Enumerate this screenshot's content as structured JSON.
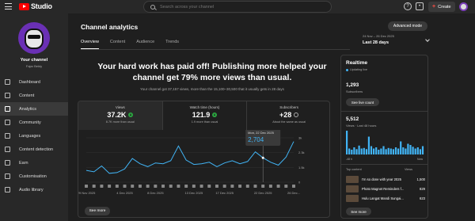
{
  "header": {
    "logo_text": "Studio",
    "search_placeholder": "Search across your channel",
    "create_label": "Create"
  },
  "sidebar": {
    "channel_name": "Your channel",
    "channel_handle": "Fajar Bekty",
    "items": [
      {
        "label": "Dashboard",
        "icon": "dashboard-icon",
        "active": false
      },
      {
        "label": "Content",
        "icon": "content-icon",
        "active": false
      },
      {
        "label": "Analytics",
        "icon": "analytics-icon",
        "active": true
      },
      {
        "label": "Community",
        "icon": "community-icon",
        "active": false
      },
      {
        "label": "Languages",
        "icon": "languages-icon",
        "active": false
      },
      {
        "label": "Content detection",
        "icon": "copyright-icon",
        "active": false
      },
      {
        "label": "Earn",
        "icon": "earn-icon",
        "active": false
      },
      {
        "label": "Customisation",
        "icon": "customisation-icon",
        "active": false
      },
      {
        "label": "Audio library",
        "icon": "audio-library-icon",
        "active": false
      }
    ]
  },
  "main": {
    "title": "Channel analytics",
    "advanced_mode": "Advanced mode",
    "tabs": [
      "Overview",
      "Content",
      "Audience",
      "Trends"
    ],
    "date_range": "24 Nov – 26 Dec 2025",
    "date_label": "Last 28 days",
    "headline": "Your hard work has paid off! Publishing more helped your channel get 79% more views than usual.",
    "subline": "Your channel got 37,157 views, more than the 15,100–30,500 that it usually gets in 28 days",
    "metrics": [
      {
        "label": "Views",
        "value": "37.2K",
        "note": "8.7K more than usual",
        "selected": true,
        "up": true
      },
      {
        "label": "Watch time (hours)",
        "value": "121.9",
        "note": "1.9 more than usual",
        "selected": false,
        "up": true
      },
      {
        "label": "Subscribers",
        "value": "+28",
        "note": "About the same as usual",
        "selected": false,
        "up": false
      }
    ],
    "see_more": "See more",
    "tooltip": {
      "date": "Mon, 22 Dec 2025",
      "value": "2,704"
    }
  },
  "chart_data": {
    "type": "line",
    "x": [
      "29 Nov 2025",
      "30 Nov",
      "1 Dec",
      "2 Dec",
      "3 Dec",
      "4 Dec 2025",
      "5 Dec",
      "6 Dec",
      "7 Dec",
      "8 Dec 2025",
      "9 Dec",
      "10 Dec",
      "11 Dec",
      "12 Dec 2025",
      "13 Dec",
      "14 Dec",
      "15 Dec",
      "16 Dec",
      "17 Dec 2025",
      "18 Dec",
      "19 Dec",
      "20 Dec",
      "21 Dec",
      "22 Dec 2025",
      "23 Dec",
      "24 Dec",
      "25 Dec",
      "26 Dec 2025"
    ],
    "values": [
      800,
      700,
      1100,
      600,
      650,
      900,
      1600,
      1250,
      1050,
      1300,
      1250,
      1450,
      2450,
      1500,
      1200,
      1250,
      1350,
      1050,
      1300,
      1450,
      1250,
      1400,
      2050,
      1650,
      1350,
      1150,
      1700,
      2750
    ],
    "tick_labels": [
      "29 Nov 2025",
      "4 Dec 2025",
      "8 Dec 2025",
      "13 Dec 2025",
      "17 Dec 2025",
      "22 Dec 2025",
      "26 Dec..."
    ],
    "y_ticks": [
      "0",
      "1.5k",
      "2.3k",
      "3k"
    ],
    "ylim": [
      0,
      3000
    ],
    "color": "#41b4f5",
    "series_name": "Views"
  },
  "realtime": {
    "title": "Realtime",
    "updating": "Updating live",
    "subscribers_value": "1,293",
    "subscribers_label": "Subscribers",
    "see_live_count": "See live count",
    "views_value": "5,512",
    "views_label": "Views · Last 48 hours",
    "axis_left": "-48 h",
    "axis_right": "Now",
    "top_content_label": "Top content",
    "views_col_label": "Views",
    "videos": [
      {
        "title": "I'm so done with year 2025",
        "views": "1,500"
      },
      {
        "title": "Photo Magnet Reminders f...",
        "views": "829"
      },
      {
        "title": "Hulu Langat Mandi Sungai...",
        "views": "623"
      }
    ],
    "see_more": "See more",
    "spark": [
      40,
      10,
      8,
      12,
      9,
      15,
      10,
      11,
      9,
      30,
      14,
      10,
      12,
      8,
      10,
      14,
      9,
      11,
      10,
      9,
      12,
      10,
      22,
      12,
      10,
      18,
      16,
      13,
      10,
      12,
      9,
      14
    ]
  }
}
